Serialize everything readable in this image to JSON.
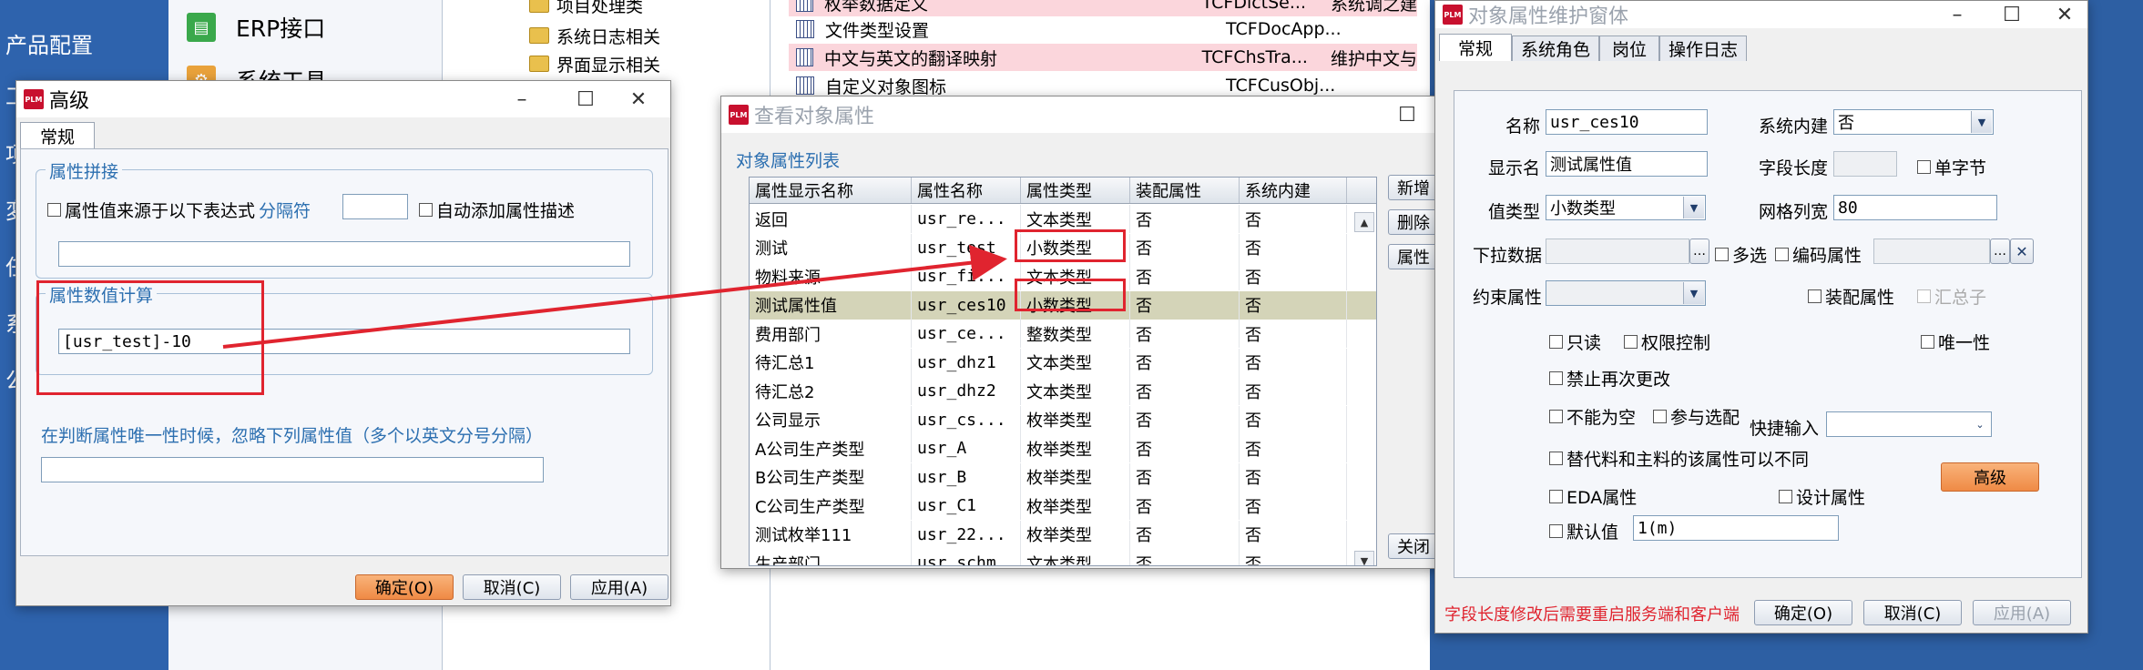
{
  "left_sidebar": {
    "items": [
      "产品配置",
      "工",
      "项",
      "変",
      "任",
      "系",
      "公"
    ]
  },
  "nav": {
    "erp_label": "ERP接口",
    "erp_icon": "erp-icon",
    "tools_label": "系统工具"
  },
  "tree": {
    "items": [
      "项目处理类",
      "系统日志相关",
      "界面显示相关"
    ]
  },
  "bg_list": {
    "rows": [
      {
        "name": "枚举数据定义",
        "code": "TCFDictSe...",
        "desc": "系统调之建"
      },
      {
        "name": "文件类型设置",
        "code": "TCFDocApp...",
        "desc": ""
      },
      {
        "name": "中文与英文的翻译映射",
        "code": "TCFChsTra...",
        "desc": "维护中文与"
      },
      {
        "name": "自定义对象图标",
        "code": "TCFCusObj...",
        "desc": ""
      }
    ]
  },
  "advanced_dialog": {
    "title": "高级",
    "tab": "常规",
    "group_concat": "属性拼接",
    "cb_value_from_expr": "属性值来源于以下表达式",
    "separator_label": "分隔符",
    "separator_value": "",
    "cb_auto_add_desc": "自动添加属性描述",
    "concat_expr": "",
    "group_calc": "属性数值计算",
    "calc_expr": "[usr_test]-10",
    "ignore_label": "在判断属性唯一性时候，忽略下列属性值（多个以英文分号分隔）",
    "ignore_value": "",
    "ok": "确定(O)",
    "cancel": "取消(C)",
    "apply": "应用(A)"
  },
  "view_dialog": {
    "title": "查看对象属性",
    "list_label": "对象属性列表",
    "columns": [
      "属性显示名称",
      "属性名称",
      "属性类型",
      "装配属性",
      "系统内建"
    ],
    "rows": [
      [
        "返回",
        "usr_re...",
        "文本类型",
        "否",
        "否"
      ],
      [
        "测试",
        "usr_test",
        "小数类型",
        "否",
        "否"
      ],
      [
        "物料来源",
        "usr_fi...",
        "文本类型",
        "否",
        "否"
      ],
      [
        "测试属性值",
        "usr_ces10",
        "小数类型",
        "否",
        "否"
      ],
      [
        "费用部门",
        "usr_ce...",
        "整数类型",
        "否",
        "否"
      ],
      [
        "待汇总1",
        "usr_dhz1",
        "文本类型",
        "否",
        "否"
      ],
      [
        "待汇总2",
        "usr_dhz2",
        "文本类型",
        "否",
        "否"
      ],
      [
        "公司显示",
        "usr_cs...",
        "枚举类型",
        "否",
        "否"
      ],
      [
        "A公司生产类型",
        "usr_A",
        "枚举类型",
        "否",
        "否"
      ],
      [
        "B公司生产类型",
        "usr_B",
        "枚举类型",
        "否",
        "否"
      ],
      [
        "C公司生产类型",
        "usr_C1",
        "枚举类型",
        "否",
        "否"
      ],
      [
        "测试枚举111",
        "usr_22...",
        "枚举类型",
        "否",
        "否"
      ],
      [
        "生产部门",
        "usr_schm",
        "文本类型",
        "否",
        "否"
      ]
    ],
    "side_buttons": [
      "新增",
      "删除",
      "属性",
      "关闭"
    ]
  },
  "maint_dialog": {
    "title": "对象属性维护窗体",
    "tabs": [
      "常规",
      "系统角色",
      "岗位",
      "操作日志"
    ],
    "name_label": "名称",
    "name_value": "usr_ces10",
    "builtin_label": "系统内建",
    "builtin_value": "否",
    "display_label": "显示名",
    "display_value": "测试属性值",
    "length_label": "字段长度",
    "length_value": "",
    "single_byte": "单字节",
    "valtype_label": "值类型",
    "valtype_value": "小数类型",
    "gridwidth_label": "网格列宽",
    "gridwidth_value": "80",
    "dropdown_label": "下拉数据",
    "dropdown_value": "",
    "multi_select": "多选",
    "encode_attr": "编码属性",
    "encode_value": "",
    "constraint_label": "约束属性",
    "constraint_value": "",
    "assembly_attr": "装配属性",
    "summary_child": "汇总子",
    "readonly": "只读",
    "permission": "权限控制",
    "unique": "唯一性",
    "no_change": "禁止再次更改",
    "not_null": "不能为空",
    "participate": "参与选配",
    "quick_input_label": "快捷输入",
    "quick_input_value": "",
    "replace_rule": "替代料和主料的该属性可以不同",
    "eda": "EDA属性",
    "design": "设计属性",
    "advanced_btn": "高级",
    "default_label": "默认值",
    "default_value": "1(m)",
    "warning": "字段长度修改后需要重启服务端和客户端",
    "ok": "确定(O)",
    "cancel": "取消(C)",
    "apply": "应用(A)"
  },
  "colors": {
    "highlight": "#e0242f",
    "accent_orange": "#ef8a45",
    "selected_row": "#d4d4b8"
  }
}
